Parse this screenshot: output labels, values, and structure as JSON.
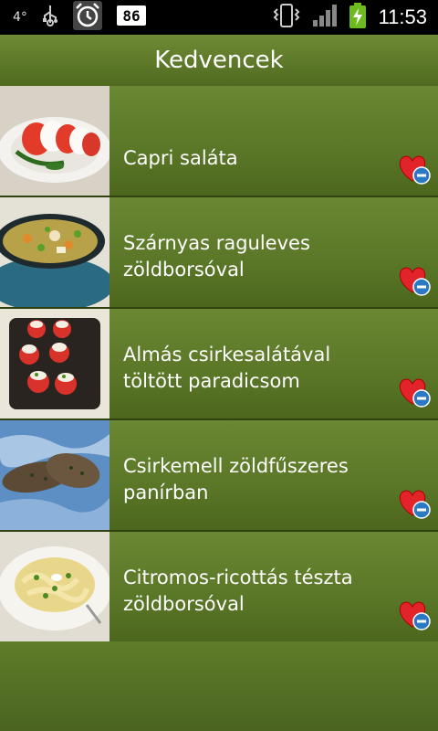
{
  "status_bar": {
    "temperature": "4°",
    "time": "11:53",
    "icons": [
      "usb-icon",
      "alarm-icon",
      "notification-86-icon",
      "vibrate-icon",
      "signal-icon",
      "battery-charging-icon"
    ],
    "badge": "86"
  },
  "header": {
    "title": "Kedvencek"
  },
  "favorites": [
    {
      "title": "Capri saláta",
      "image": "caprese-salad"
    },
    {
      "title": "Szárnyas raguleves zöldborsóval",
      "image": "chicken-soup"
    },
    {
      "title": "Almás csirkesalátával töltött paradicsom",
      "image": "stuffed-tomatoes"
    },
    {
      "title": "Csirkemell zöldfűszeres panírban",
      "image": "breaded-chicken"
    },
    {
      "title": "Citromos-ricottás tészta zöldborsóval",
      "image": "lemon-ricotta-pasta"
    }
  ],
  "colors": {
    "accent_green": "#5d7a2b",
    "heart_red": "#e2232a",
    "minus_blue": "#2b79c2"
  }
}
